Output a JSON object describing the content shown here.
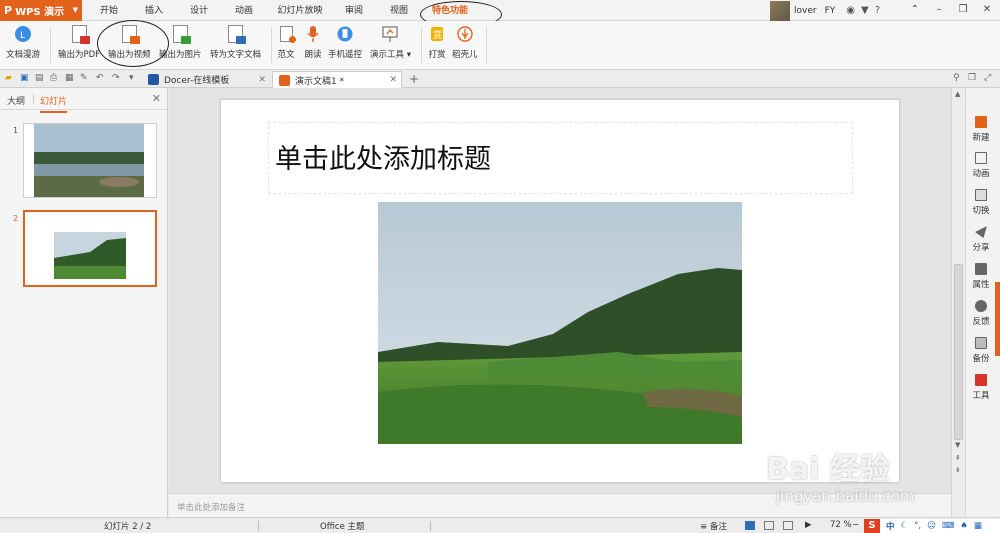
{
  "app": {
    "name": "WPS 演示"
  },
  "menu_tabs": [
    "开始",
    "插入",
    "设计",
    "动画",
    "幻灯片放映",
    "审阅",
    "视图",
    "特色功能"
  ],
  "user": {
    "name": "lover",
    "extra": "FY"
  },
  "ribbon": {
    "items": [
      {
        "label": "文档漫游",
        "icon": "cloud-icon"
      },
      {
        "label": "输出为PDF",
        "icon": "pdf-export-icon"
      },
      {
        "label": "输出为视频",
        "icon": "video-export-icon"
      },
      {
        "label": "输出为图片",
        "icon": "image-export-icon"
      },
      {
        "label": "转为文字文档",
        "icon": "to-text-doc-icon"
      },
      {
        "label": "范文",
        "icon": "template-icon"
      },
      {
        "label": "朗读",
        "icon": "microphone-icon"
      },
      {
        "label": "手机遥控",
        "icon": "remote-icon"
      },
      {
        "label": "演示工具",
        "icon": "presentation-tool-icon"
      },
      {
        "label": "打赏",
        "icon": "reward-icon"
      },
      {
        "label": "稻壳儿",
        "icon": "docer-icon"
      }
    ]
  },
  "doc_tabs": [
    {
      "label": "Docer-在线模板"
    },
    {
      "label": "演示文稿1 *"
    }
  ],
  "left_pane": {
    "tabs": [
      "大纲",
      "幻灯片"
    ],
    "slides": [
      "1",
      "2"
    ]
  },
  "slide": {
    "title_placeholder": "单击此处添加标题"
  },
  "notes_placeholder": "单击此处添加备注",
  "right_bar": [
    "新建",
    "动画",
    "切换",
    "分享",
    "属性",
    "反馈",
    "备份",
    "工具"
  ],
  "status": {
    "slide_counter": "幻灯片 2 / 2",
    "theme": "Office 主题",
    "notes_label": "备注",
    "zoom": "72 %",
    "ime_mode": "中"
  },
  "watermark": {
    "main": "Bai 经验",
    "sub": "jingyan.baidu.com"
  },
  "colors": {
    "accent": "#e2611b",
    "blue": "#2f6eb7"
  }
}
